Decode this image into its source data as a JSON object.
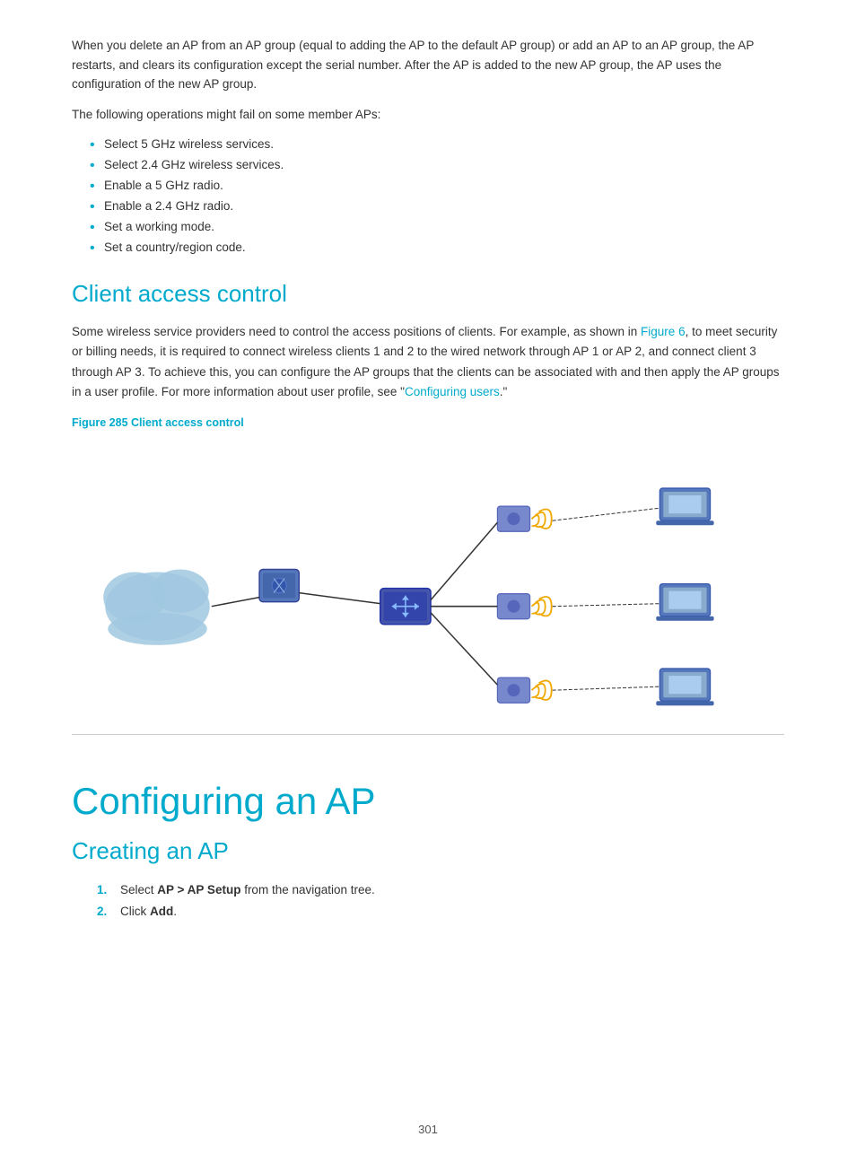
{
  "intro": {
    "paragraph1": "When you delete an AP from an AP group (equal to adding the AP to the default AP group) or add an AP to an AP group, the AP restarts, and clears its configuration except the serial number. After the AP is added to the new AP group, the AP uses the configuration of the new AP group.",
    "paragraph2": "The following operations might fail on some member APs:",
    "bullets": [
      "Select 5 GHz wireless services.",
      "Select 2.4 GHz wireless services.",
      "Enable a 5 GHz radio.",
      "Enable a 2.4 GHz radio.",
      "Set a working mode.",
      "Set a country/region code."
    ]
  },
  "client_access": {
    "heading": "Client access control",
    "body": "Some wireless service providers need to control the access positions of clients. For example, as shown in Figure 6, to meet security or billing needs, it is required to connect wireless clients 1 and 2 to the wired network through AP 1 or AP 2, and connect client 3 through AP 3. To achieve this, you can configure the AP groups that the clients can be associated with and then apply the AP groups in a user profile. For more information about user profile, see \"Configuring users.\"",
    "figure_label": "Figure 285 Client access control"
  },
  "configuring": {
    "heading": "Configuring an AP",
    "subheading": "Creating an AP",
    "steps": [
      {
        "num": "1.",
        "text": "Select ",
        "bold": "AP > AP Setup",
        "suffix": " from the navigation tree."
      },
      {
        "num": "2.",
        "text": "Click ",
        "bold": "Add",
        "suffix": "."
      }
    ]
  },
  "page_number": "301",
  "colors": {
    "accent": "#00aacc",
    "text": "#333333"
  }
}
